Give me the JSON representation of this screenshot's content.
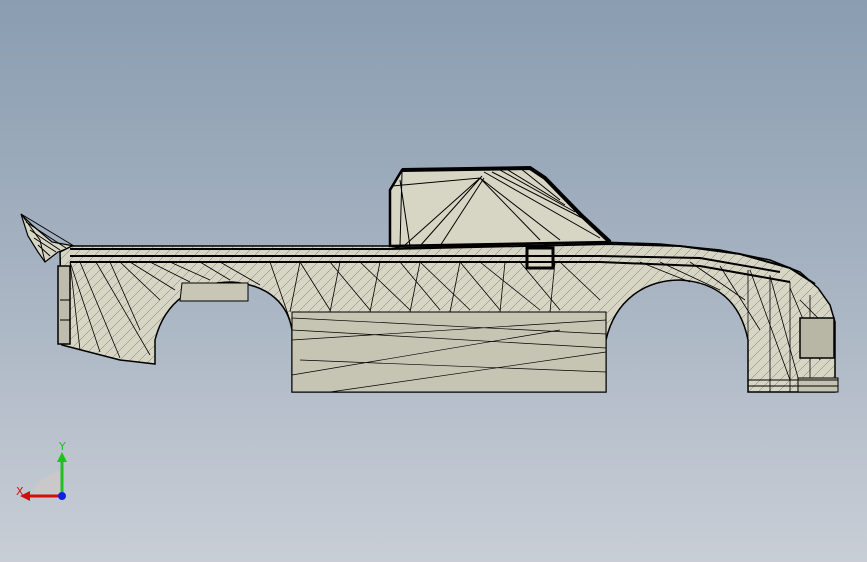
{
  "viewport": {
    "model_name": "",
    "background": [
      "#8a9db1",
      "#c9ced6"
    ],
    "colors": {
      "body_fill": "#d7d6c4",
      "body_fill_dark": "#bdbcab",
      "edge_line": "#000000"
    }
  },
  "triad": {
    "x_label": "X",
    "y_label": "Y",
    "x_color": "#d01010",
    "y_color": "#20c020",
    "z_color": "#1020e0",
    "plane_color": "#c9c9c9"
  }
}
